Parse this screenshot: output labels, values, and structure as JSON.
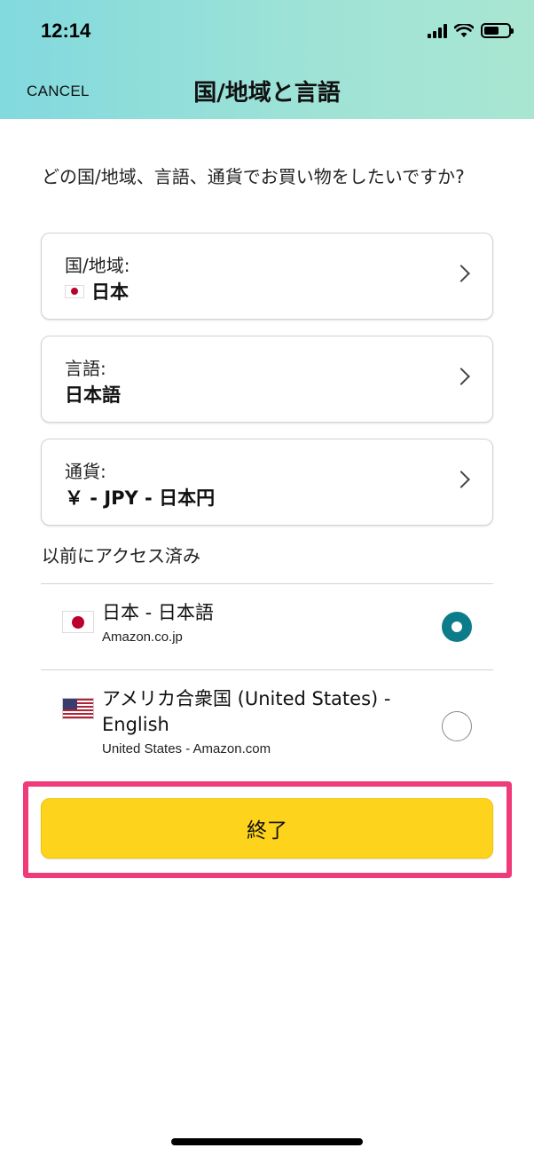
{
  "status_bar": {
    "time": "12:14"
  },
  "header": {
    "cancel_label": "CANCEL",
    "title": "国/地域と言語"
  },
  "question": "どの国/地域、言語、通貨でお買い物をしたいですか?",
  "settings": [
    {
      "label": "国/地域:",
      "value": "日本",
      "flag": "japan-flag-icon"
    },
    {
      "label": "言語:",
      "value": "日本語"
    },
    {
      "label": "通貨:",
      "value": "￥ - JPY - 日本円"
    }
  ],
  "previously_visited": {
    "label": "以前にアクセス済み",
    "options": [
      {
        "title": "日本 - 日本語",
        "subtitle": "Amazon.co.jp",
        "selected": true,
        "flag": "japan-flag-icon"
      },
      {
        "title": "アメリカ合衆国 (United States) - English",
        "subtitle": "United States - Amazon.com",
        "selected": false,
        "flag": "us-flag-icon"
      }
    ]
  },
  "done_button": {
    "label": "終了"
  },
  "colors": {
    "accent_teal": "#0d7c8a",
    "button_yellow": "#fed31b",
    "highlight_pink": "#f03b7a"
  }
}
